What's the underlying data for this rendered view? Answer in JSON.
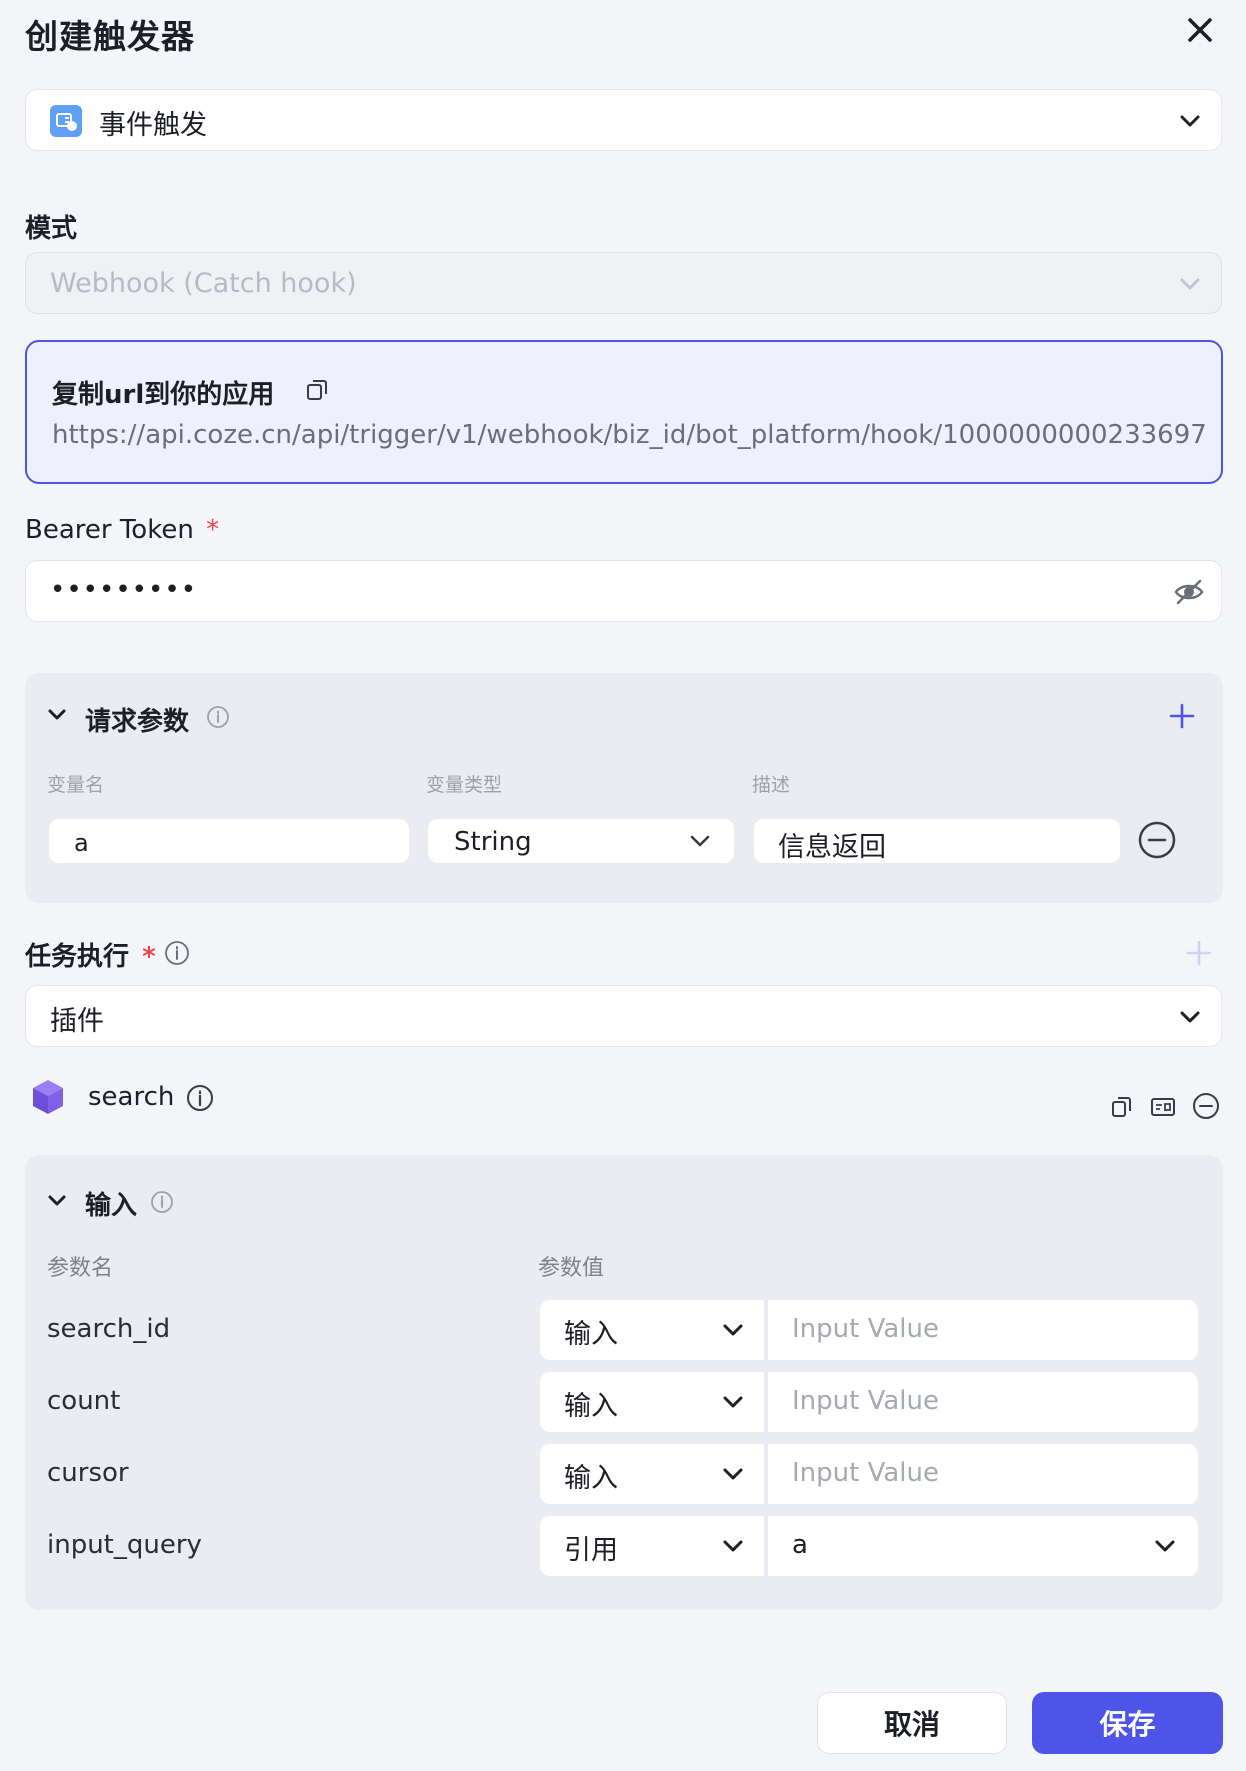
{
  "dialog": {
    "title": "创建触发器"
  },
  "trigger_type": {
    "value": "事件触发"
  },
  "mode": {
    "label": "模式",
    "value": "Webhook (Catch hook)"
  },
  "webhook": {
    "copy_label": "复制url到你的应用",
    "url": "https://api.coze.cn/api/trigger/v1/webhook/biz_id/bot_platform/hook/1000000000233697..."
  },
  "bearer": {
    "label": "Bearer Token",
    "required_mark": "*",
    "value": "•••••••••"
  },
  "request_params": {
    "title": "请求参数",
    "headers": [
      "变量名",
      "变量类型",
      "描述"
    ],
    "rows": [
      {
        "name": "a",
        "type": "String",
        "desc": "信息返回"
      }
    ]
  },
  "task": {
    "label": "任务执行",
    "required_mark": "*",
    "value": "插件"
  },
  "plugin": {
    "name": "search"
  },
  "input_section": {
    "title": "输入",
    "headers": [
      "参数名",
      "参数值"
    ],
    "rows": [
      {
        "name": "search_id",
        "mode": "输入",
        "value": "",
        "placeholder": "Input Value"
      },
      {
        "name": "count",
        "mode": "输入",
        "value": "",
        "placeholder": "Input Value"
      },
      {
        "name": "cursor",
        "mode": "输入",
        "value": "",
        "placeholder": "Input Value"
      },
      {
        "name": "input_query",
        "mode": "引用",
        "value": "a",
        "placeholder": ""
      }
    ]
  },
  "footer": {
    "cancel": "取消",
    "save": "保存"
  },
  "colors": {
    "primary": "#4e54e8",
    "webhook_bg": "#eef0fd",
    "webhook_border": "#4e54e8",
    "required": "#e5484d"
  }
}
